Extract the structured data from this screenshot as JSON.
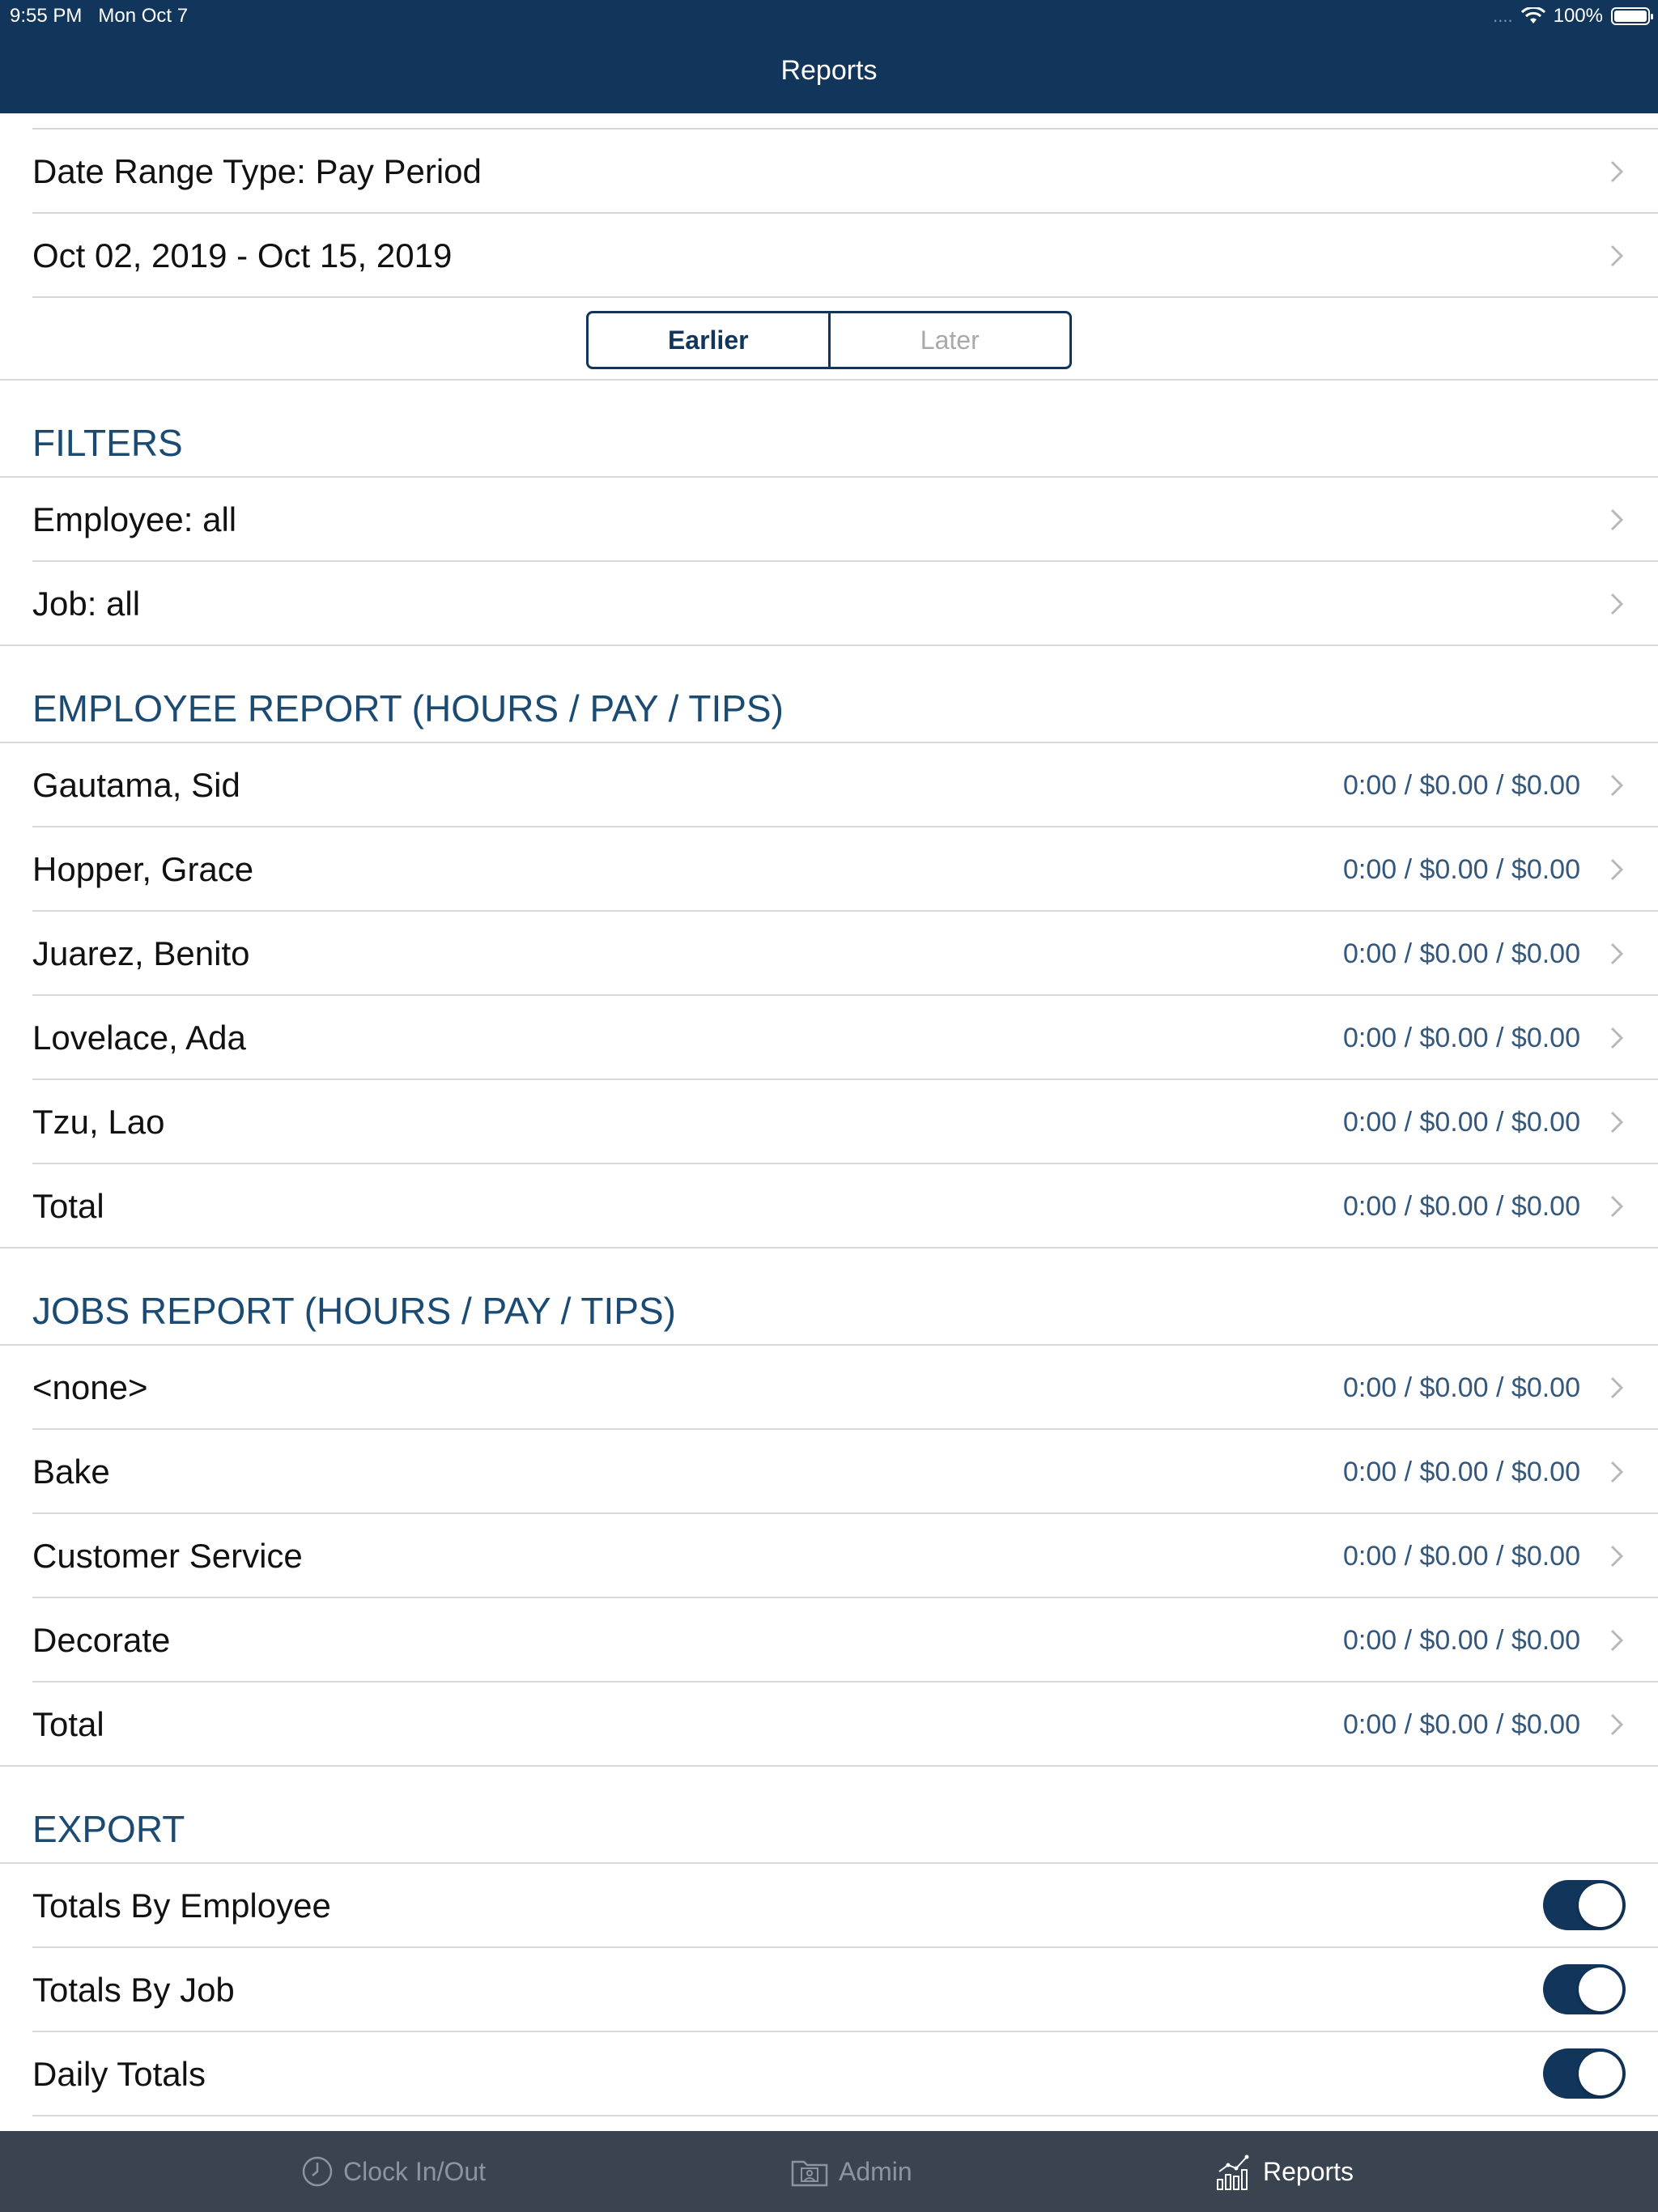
{
  "status_bar": {
    "time": "9:55 PM",
    "date": "Mon Oct 7",
    "signal": "....",
    "battery": "100%",
    "battery_level": 1.0
  },
  "nav": {
    "title": "Reports"
  },
  "date_range": {
    "type_label": "Date Range Type: Pay Period",
    "range_label": "Oct 02, 2019 - Oct 15, 2019",
    "earlier": "Earlier",
    "later": "Later"
  },
  "filters": {
    "header": "FILTERS",
    "employee": "Employee: all",
    "job": "Job: all"
  },
  "employee_report": {
    "header": "EMPLOYEE REPORT (HOURS / PAY / TIPS)",
    "rows": [
      {
        "name": "Gautama, Sid",
        "value": "0:00 / $0.00 / $0.00"
      },
      {
        "name": "Hopper, Grace",
        "value": "0:00 / $0.00 / $0.00"
      },
      {
        "name": "Juarez, Benito",
        "value": "0:00 / $0.00 / $0.00"
      },
      {
        "name": "Lovelace, Ada",
        "value": "0:00 / $0.00 / $0.00"
      },
      {
        "name": "Tzu, Lao",
        "value": "0:00 / $0.00 / $0.00"
      },
      {
        "name": "Total",
        "value": "0:00 / $0.00 / $0.00"
      }
    ]
  },
  "jobs_report": {
    "header": "JOBS REPORT (HOURS / PAY / TIPS)",
    "rows": [
      {
        "name": "<none>",
        "value": "0:00 / $0.00 / $0.00"
      },
      {
        "name": "Bake",
        "value": "0:00 / $0.00 / $0.00"
      },
      {
        "name": "Customer Service",
        "value": "0:00 / $0.00 / $0.00"
      },
      {
        "name": "Decorate",
        "value": "0:00 / $0.00 / $0.00"
      },
      {
        "name": "Total",
        "value": "0:00 / $0.00 / $0.00"
      }
    ]
  },
  "export": {
    "header": "EXPORT",
    "items": [
      {
        "label": "Totals By Employee",
        "on": true
      },
      {
        "label": "Totals By Job",
        "on": true
      },
      {
        "label": "Daily Totals",
        "on": true
      }
    ]
  },
  "tab_bar": {
    "tabs": [
      {
        "label": "Clock In/Out",
        "icon": "clock-icon",
        "active": false
      },
      {
        "label": "Admin",
        "icon": "admin-folder-icon",
        "active": false
      },
      {
        "label": "Reports",
        "icon": "bar-chart-icon",
        "active": true
      }
    ]
  },
  "colors": {
    "brand_navy": "#12355b",
    "section_header": "#1b4b73",
    "value_text": "#33577d",
    "tab_bar_bg": "#3a4450"
  }
}
